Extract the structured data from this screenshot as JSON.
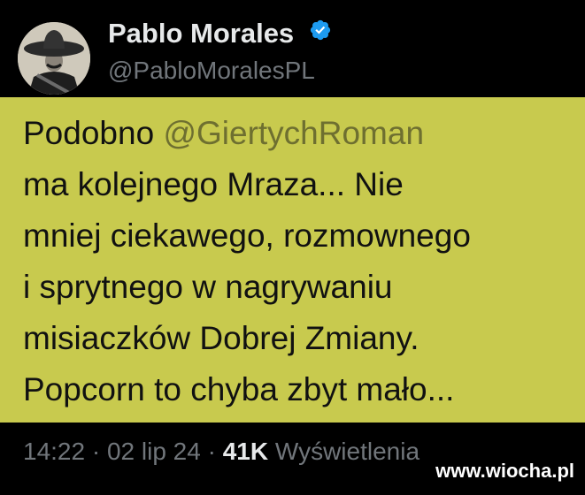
{
  "author": {
    "display_name": "Pablo Morales",
    "handle": "@PabloMoralesPL",
    "verified": true,
    "verified_color": "#1d9bf0"
  },
  "tweet": {
    "background_color": "#c8ca4e",
    "line1_prefix": "Podobno ",
    "mention": "@GiertychRoman",
    "line2": "ma kolejnego Mraza... Nie",
    "line3": "mniej ciekawego, rozmownego",
    "line4": "i sprytnego w nagrywaniu",
    "line5": "misiaczków Dobrej Zmiany.",
    "line6": "Popcorn to chyba zbyt mało..."
  },
  "meta": {
    "time": "14:22",
    "separator1": " · ",
    "date": "02 lip 24",
    "separator2": " · ",
    "views_count": "41K",
    "views_label": " Wyświetlenia"
  },
  "watermark": {
    "text": "www.wiocha.pl"
  },
  "icons": {
    "verified": "verified-badge-icon",
    "avatar": "avatar-image"
  }
}
